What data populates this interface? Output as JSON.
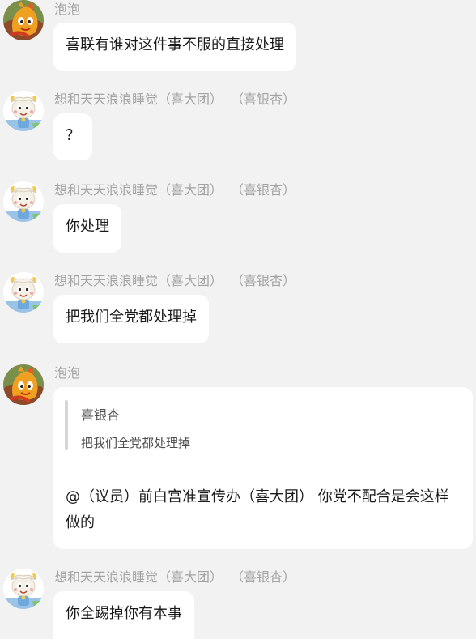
{
  "messages": [
    {
      "sender": "泡泡",
      "text": "喜联有谁对这件事不服的直接处理"
    },
    {
      "sender": "想和天天浪浪睡觉（喜大团）",
      "title": "（喜银杏）",
      "text": "？"
    },
    {
      "sender": "想和天天浪浪睡觉（喜大团）",
      "title": "（喜银杏）",
      "text": "你处理"
    },
    {
      "sender": "想和天天浪浪睡觉（喜大团）",
      "title": "（喜银杏）",
      "text": "把我们全党都处理掉"
    },
    {
      "sender": "泡泡",
      "quote_author": "喜银杏",
      "quote_text": "把我们全党都处理掉",
      "text": "@（议员）前白宫准宣传办（喜大团） 你党不配合是会这样做的"
    },
    {
      "sender": "想和天天浪浪睡觉（喜大团）",
      "title": "（喜银杏）",
      "text": "你全踢掉你有本事"
    }
  ],
  "colors": {
    "background": "#f2f2f2",
    "bubble": "#ffffff",
    "nickname": "#a3a3a3",
    "text": "#1a1a1a",
    "quote_bar": "#d6d6d6"
  },
  "icons": {
    "paopao_avatar": "orange-cartoon-character-avatar",
    "goat_avatar": "cartoon-goat-avatar"
  }
}
